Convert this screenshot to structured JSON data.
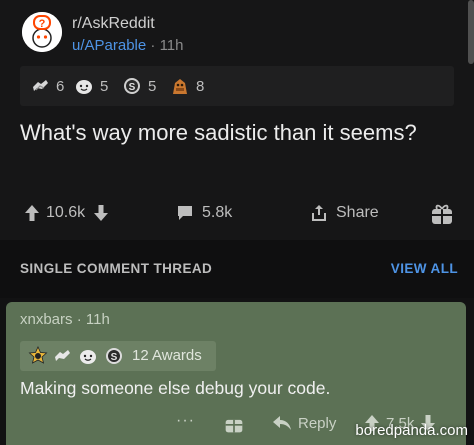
{
  "post": {
    "subreddit": "r/AskReddit",
    "author": "u/AParable",
    "separator": "·",
    "age": "11h",
    "awards": [
      {
        "icon": "helping-hand-icon",
        "count": "6"
      },
      {
        "icon": "wholesome-icon",
        "count": "5"
      },
      {
        "icon": "silver-icon",
        "count": "5"
      },
      {
        "icon": "bravo-icon",
        "count": "8"
      }
    ],
    "title": "What's way more sadistic than it seems?",
    "upvotes": "10.6k",
    "comments": "5.8k",
    "share_label": "Share"
  },
  "thread": {
    "label": "SINGLE COMMENT THREAD",
    "view_all": "VIEW ALL"
  },
  "comment": {
    "author": "xnxbars",
    "separator": "·",
    "age": "11h",
    "awards_label": "12 Awards",
    "body": "Making someone else debug your code.",
    "reply_label": "Reply",
    "upvotes": "7.5k",
    "more": "···"
  },
  "watermark": "boredpanda.com",
  "colors": {
    "accent_blue": "#4e94e6",
    "highlight_green": "#5c7155",
    "background": "#121213"
  }
}
